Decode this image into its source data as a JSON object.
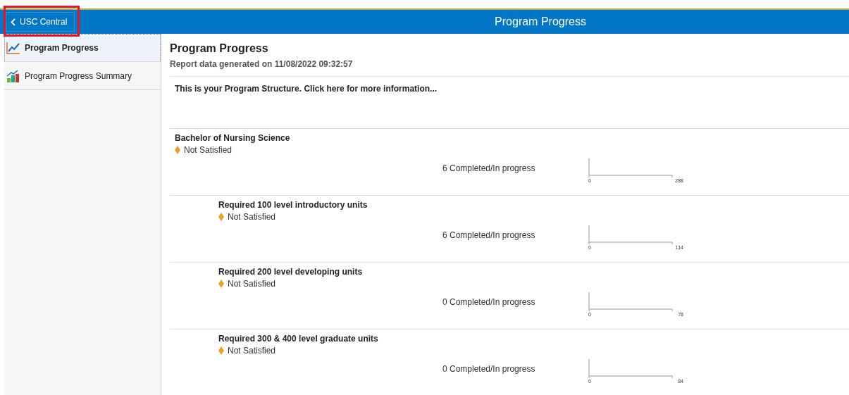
{
  "header": {
    "back_label": "USC Central",
    "title": "Program Progress",
    "highlighted": true
  },
  "sidebar": {
    "items": [
      {
        "label": "Program Progress",
        "selected": true,
        "kind": "line"
      },
      {
        "label": "Program Progress Summary",
        "selected": false,
        "kind": "bars"
      }
    ]
  },
  "content": {
    "title": "Program Progress",
    "generated": "Report data generated on 11/08/2022 09:32:57",
    "info": "This is your Program Structure. Click here for more information...",
    "requirements": [
      {
        "name": "Bachelor of Nursing Science",
        "status": "Not Satisfied",
        "progress": "6 Completed/In progress",
        "axis_min": "0",
        "axis_max": "288",
        "nested": false
      },
      {
        "name": "Required 100 level introductory units",
        "status": "Not Satisfied",
        "progress": "6 Completed/In progress",
        "axis_min": "0",
        "axis_max": "114",
        "nested": true
      },
      {
        "name": "Required 200 level developing units",
        "status": "Not Satisfied",
        "progress": "0 Completed/In progress",
        "axis_min": "0",
        "axis_max": "78",
        "nested": true
      },
      {
        "name": "Required 300 & 400 level graduate units",
        "status": "Not Satisfied",
        "progress": "0 Completed/In progress",
        "axis_min": "0",
        "axis_max": "84",
        "nested": true
      }
    ]
  }
}
